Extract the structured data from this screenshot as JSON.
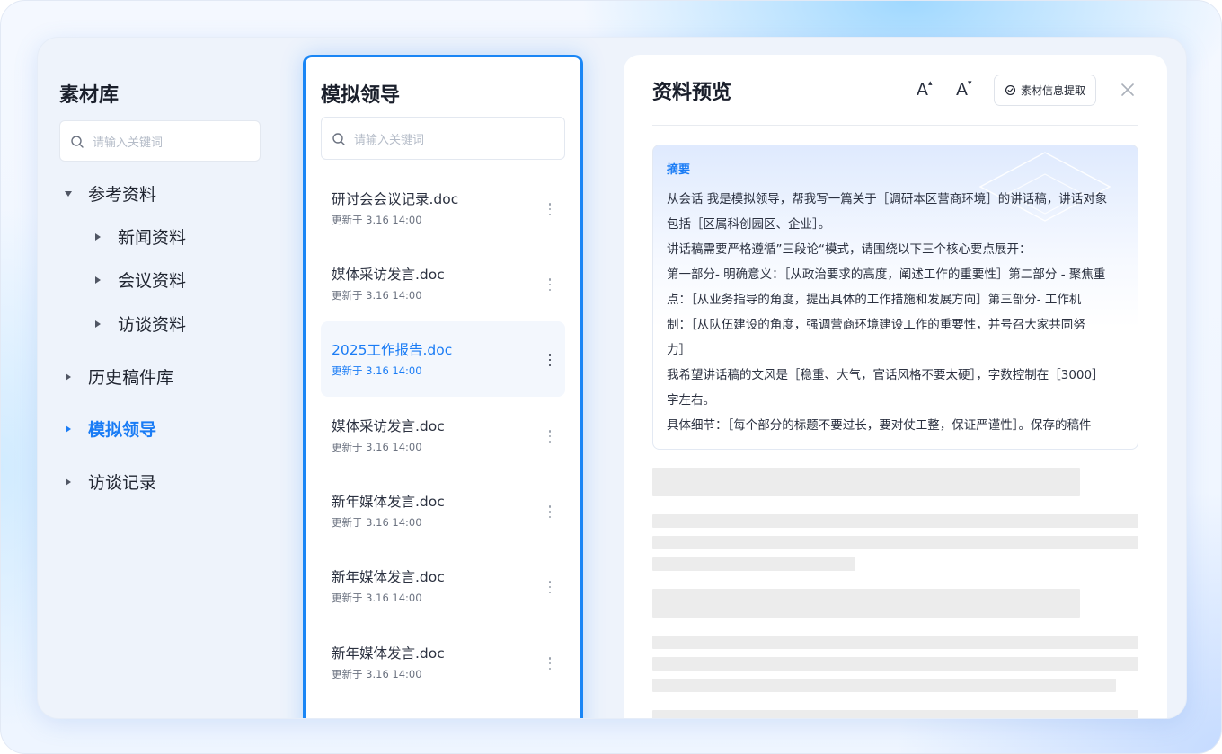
{
  "sidebar": {
    "title": "素材库",
    "search_placeholder": "请输入关键词",
    "tree": [
      {
        "label": "参考资料",
        "expanded": true
      },
      {
        "label": "新闻资料"
      },
      {
        "label": "会议资料"
      },
      {
        "label": "访谈资料"
      },
      {
        "label": "历史稿件库"
      },
      {
        "label": "模拟领导",
        "active": true
      },
      {
        "label": "访谈记录"
      }
    ]
  },
  "list": {
    "title": "模拟领导",
    "search_placeholder": "请输入关键词",
    "items": [
      {
        "name": "研讨会会议记录.doc",
        "time": "更新于 3.16 14:00"
      },
      {
        "name": "媒体采访发言.doc",
        "time": "更新于 3.16 14:00"
      },
      {
        "name": "2025工作报告.doc",
        "time": "更新于 3.16 14:00",
        "active": true
      },
      {
        "name": "媒体采访发言.doc",
        "time": "更新于 3.16 14:00"
      },
      {
        "name": "新年媒体发言.doc",
        "time": "更新于 3.16 14:00"
      },
      {
        "name": "新年媒体发言.doc",
        "time": "更新于 3.16 14:00"
      },
      {
        "name": "新年媒体发言.doc",
        "time": "更新于 3.16 14:00"
      }
    ]
  },
  "preview": {
    "title": "资料预览",
    "font_increase": "A",
    "font_decrease": "A",
    "extract_label": "素材信息提取",
    "summary_title": "摘要",
    "summary_lines": [
      "从会话 我是模拟领导，帮我写一篇关于［调研本区营商环境］的讲话稿，讲话对象",
      "包括［区属科创园区、企业］。",
      "讲话稿需要严格遵循”三段论“模式，请围绕以下三个核心要点展开：",
      "第一部分- 明确意义：［从政治要求的高度，阐述工作的重要性］第二部分 - 聚焦重",
      "点：［从业务指导的角度，提出具体的工作措施和发展方向］第三部分- 工作机",
      "制：［从队伍建设的角度，强调营商环境建设工作的重要性，并号召大家共同努",
      "力］",
      "我希望讲话稿的文风是［稳重、大气，官话风格不要太硬］，字数控制在［3000］",
      "字左右。",
      "具体细节：［每个部分的标题不要过长，要对仗工整，保证严谨性］。保存的稿件"
    ]
  },
  "colors": {
    "accent": "#1a7cf5",
    "text": "#1f2430",
    "muted": "#6b7280",
    "skeleton": "#ececec"
  },
  "icons": [
    "search-icon",
    "caret-down-icon",
    "caret-right-icon",
    "more-vertical-icon",
    "font-increase-icon",
    "font-decrease-icon",
    "extract-icon",
    "close-icon"
  ]
}
